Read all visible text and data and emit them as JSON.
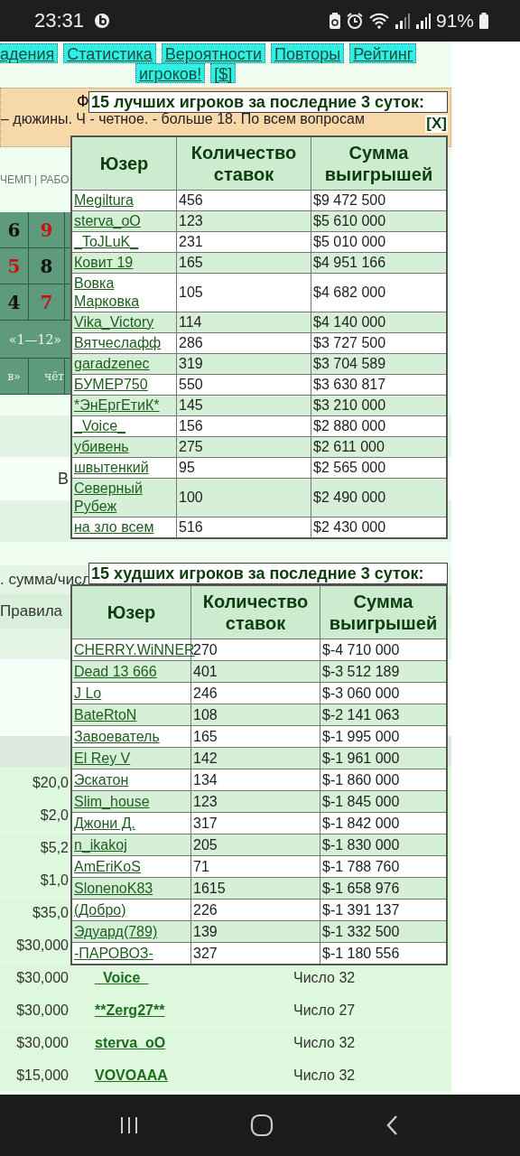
{
  "status_bar": {
    "time": "23:31",
    "battery": "91%"
  },
  "nav_rows": [
    [
      "адения",
      "Статистика",
      "Вероятности",
      "Повторы",
      "Рейтинг"
    ],
    [
      "игроков!",
      "[$]"
    ]
  ],
  "notice": {
    "head": "Ф",
    "text": "– дюжины. Ч - четное. - больше 18. По всем вопросам"
  },
  "menu_fragment": "ЧЕМП | РАБО",
  "number_grid": {
    "rows": [
      [
        {
          "label": "6",
          "color": "#111111"
        },
        {
          "label": "9",
          "color": "#cc1111"
        }
      ],
      [
        {
          "label": "5",
          "color": "#cc1111"
        },
        {
          "label": "8",
          "color": "#111111"
        }
      ],
      [
        {
          "label": "4",
          "color": "#111111"
        },
        {
          "label": "7",
          "color": "#cc1111"
        }
      ]
    ],
    "range": "«1—12»",
    "bottom": [
      "в»",
      "чёт"
    ]
  },
  "side_letter": "В",
  "labels": [
    ". сумма/числ",
    "Правила"
  ],
  "bets": [
    {
      "amount": "$20,0"
    },
    {
      "amount": "$2,0"
    },
    {
      "amount": "$5,2"
    },
    {
      "amount": "$1,0"
    },
    {
      "amount": "$35,0"
    },
    {
      "amount": "$30,000"
    },
    {
      "amount": "$30,000",
      "user": "_Voice_",
      "bet": "Число 32"
    },
    {
      "amount": "$30,000",
      "user": "**Zerg27**",
      "bet": "Число 27"
    },
    {
      "amount": "$30,000",
      "user": "sterva_oO",
      "bet": "Число 32"
    },
    {
      "amount": "$15,000",
      "user": "VOVOAAA",
      "bet": "Число 32"
    }
  ],
  "best_popup": {
    "title": "15 лучших игроков за последние 3 суток:",
    "close": "[X]",
    "columns": [
      "Юзер",
      "Количество ставок",
      "Сумма выигрышей"
    ],
    "rows": [
      {
        "user": "Megiltura",
        "bets": "456",
        "sum": "$9 472 500"
      },
      {
        "user": "sterva_oO",
        "bets": "123",
        "sum": "$5 610 000"
      },
      {
        "user": "_ToJLuK_",
        "bets": "231",
        "sum": "$5 010 000"
      },
      {
        "user": "Ковит 19",
        "bets": "165",
        "sum": "$4 951 166"
      },
      {
        "user": "Вовка Марковка",
        "bets": "105",
        "sum": "$4 682 000"
      },
      {
        "user": "Vika_Victory",
        "bets": "114",
        "sum": "$4 140 000"
      },
      {
        "user": "Вятчеслафф",
        "bets": "286",
        "sum": "$3 727 500"
      },
      {
        "user": "garadzenec",
        "bets": "319",
        "sum": "$3 704 589"
      },
      {
        "user": "БУМЕР750",
        "bets": "550",
        "sum": "$3 630 817"
      },
      {
        "user": "*ЭнЕргЕтиК*",
        "bets": "145",
        "sum": "$3 210 000"
      },
      {
        "user": "_Voice_",
        "bets": "156",
        "sum": "$2 880 000"
      },
      {
        "user": "убивень",
        "bets": "275",
        "sum": "$2 611 000"
      },
      {
        "user": "швытенкий",
        "bets": "95",
        "sum": "$2 565 000"
      },
      {
        "user": "Северный Рубеж",
        "bets": "100",
        "sum": "$2 490 000"
      },
      {
        "user": "на зло всем",
        "bets": "516",
        "sum": "$2 430 000"
      }
    ]
  },
  "worst_popup": {
    "title": "15 худших игроков за последние 3 суток:",
    "columns": [
      "Юзер",
      "Количество ставок",
      "Сумма выигрышей"
    ],
    "rows": [
      {
        "user": "CHERRY.WiNNER",
        "bets": "270",
        "sum": "$-4 710 000"
      },
      {
        "user": "Dead 13 666",
        "bets": "401",
        "sum": "$-3 512 189"
      },
      {
        "user": "J Lo",
        "bets": "246",
        "sum": "$-3 060 000"
      },
      {
        "user": "BateRtoN",
        "bets": "108",
        "sum": "$-2 141 063"
      },
      {
        "user": "Завоеватель",
        "bets": "165",
        "sum": "$-1 995 000"
      },
      {
        "user": "El Rey V",
        "bets": "142",
        "sum": "$-1 961 000"
      },
      {
        "user": "Эскатон",
        "bets": "134",
        "sum": "$-1 860 000"
      },
      {
        "user": "Slim_house",
        "bets": "123",
        "sum": "$-1 845 000"
      },
      {
        "user": "Джони Д.",
        "bets": "317",
        "sum": "$-1 842 000"
      },
      {
        "user": "n_ikakoj",
        "bets": "205",
        "sum": "$-1 830 000"
      },
      {
        "user": "AmEriKoS",
        "bets": "71",
        "sum": "$-1 788 760"
      },
      {
        "user": "SlonenoK83",
        "bets": "1615",
        "sum": "$-1 658 976"
      },
      {
        "user": "(Добро)",
        "bets": "226",
        "sum": "$-1 391 137"
      },
      {
        "user": "Эдуард(789)",
        "bets": "139",
        "sum": "$-1 332 500"
      },
      {
        "user": "-ПАРОВОЗ-",
        "bets": "327",
        "sum": "$-1 180 556"
      }
    ]
  }
}
